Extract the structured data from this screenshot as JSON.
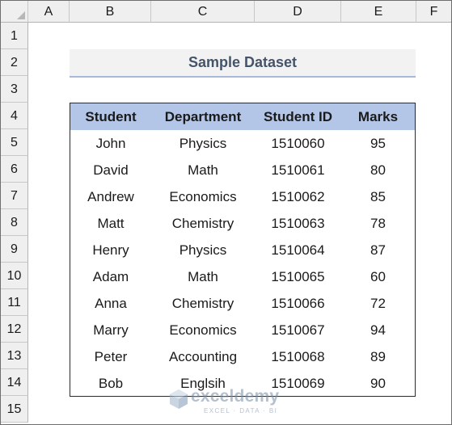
{
  "columns": [
    "A",
    "B",
    "C",
    "D",
    "E",
    "F"
  ],
  "rows": [
    "1",
    "2",
    "3",
    "4",
    "5",
    "6",
    "7",
    "8",
    "9",
    "10",
    "11",
    "12",
    "13",
    "14",
    "15"
  ],
  "title": "Sample Dataset",
  "table": {
    "headers": [
      "Student",
      "Department",
      "Student ID",
      "Marks"
    ],
    "rows": [
      [
        "John",
        "Physics",
        "1510060",
        "95"
      ],
      [
        "David",
        "Math",
        "1510061",
        "80"
      ],
      [
        "Andrew",
        "Economics",
        "1510062",
        "85"
      ],
      [
        "Matt",
        "Chemistry",
        "1510063",
        "78"
      ],
      [
        "Henry",
        "Physics",
        "1510064",
        "87"
      ],
      [
        "Adam",
        "Math",
        "1510065",
        "60"
      ],
      [
        "Anna",
        "Chemistry",
        "1510066",
        "72"
      ],
      [
        "Marry",
        "Economics",
        "1510067",
        "94"
      ],
      [
        "Peter",
        "Accounting",
        "1510068",
        "89"
      ],
      [
        "Bob",
        "Englsih",
        "1510069",
        "90"
      ]
    ]
  },
  "watermark": {
    "name": "exceldemy",
    "tagline": "EXCEL · DATA · BI"
  },
  "colors": {
    "header_fill": "#b4c6e7",
    "title_fill": "#f2f2f2",
    "title_text": "#44546a",
    "title_underline": "#a7b8d9"
  }
}
